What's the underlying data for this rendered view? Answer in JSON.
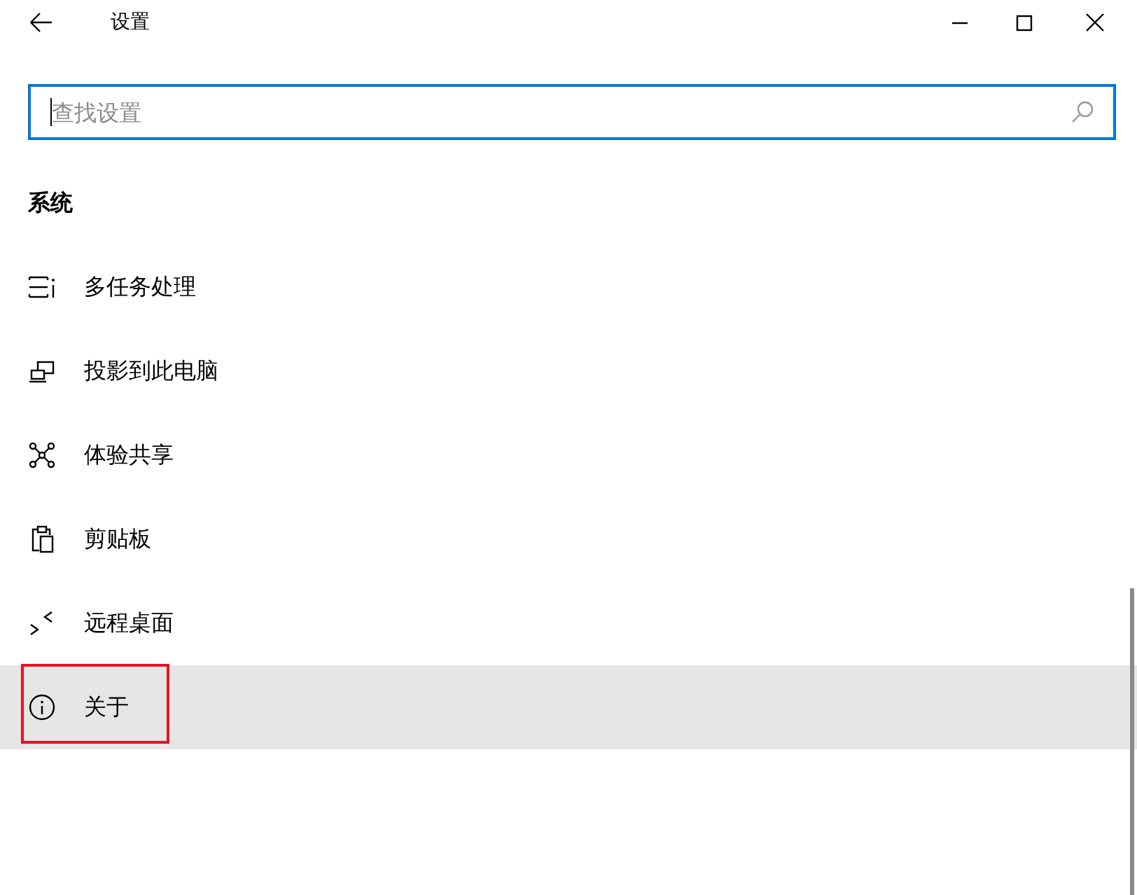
{
  "window": {
    "title": "设置"
  },
  "search": {
    "placeholder": "查找设置",
    "focused": true
  },
  "section": {
    "title": "系统"
  },
  "items": [
    {
      "label": "多任务处理",
      "selected": false,
      "highlighted": false
    },
    {
      "label": "投影到此电脑",
      "selected": false,
      "highlighted": false
    },
    {
      "label": "体验共享",
      "selected": false,
      "highlighted": false
    },
    {
      "label": "剪贴板",
      "selected": false,
      "highlighted": false
    },
    {
      "label": "远程桌面",
      "selected": false,
      "highlighted": false
    },
    {
      "label": "关于",
      "selected": true,
      "highlighted": true
    }
  ]
}
